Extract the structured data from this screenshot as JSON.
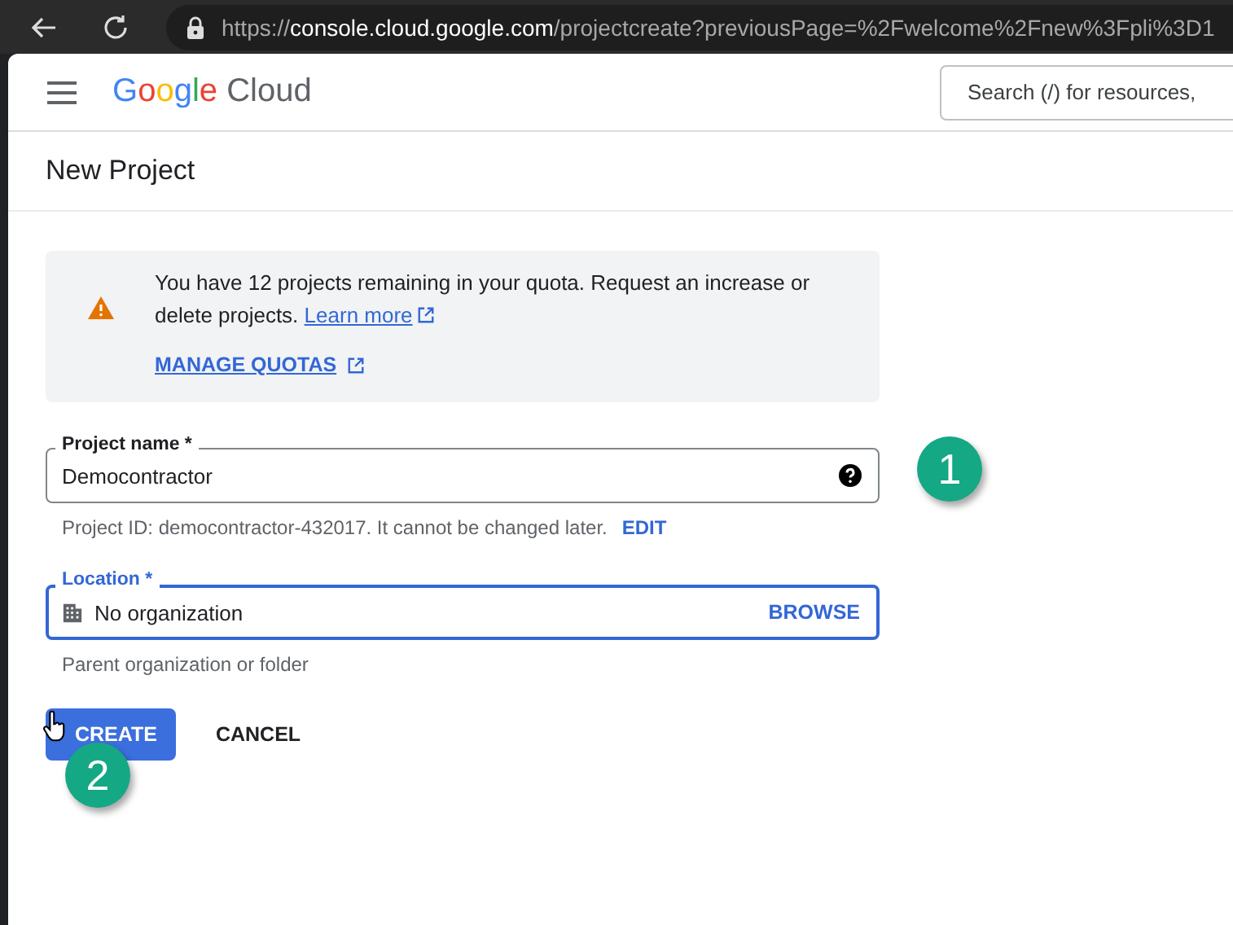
{
  "browser": {
    "url": {
      "scheme": "https://",
      "host": "console.cloud.google.com",
      "path": "/projectcreate?previousPage=%2Fwelcome%2Fnew%3Fpli%3D1"
    }
  },
  "header": {
    "logo": {
      "brand": "Google",
      "product": "Cloud"
    },
    "search": {
      "placeholder": "Search (/) for resources,"
    }
  },
  "page": {
    "title": "New Project"
  },
  "notice": {
    "text": "You have 12 projects remaining in your quota. Request an increase or delete projects.",
    "link": "Learn more",
    "action": "MANAGE QUOTAS"
  },
  "fields": [
    {
      "kind": "text",
      "label": "Project name *",
      "value": "Democontractor",
      "focused": false,
      "hint": "Project ID: democontractor-432017. It cannot be changed later.",
      "hint_action": "EDIT"
    },
    {
      "kind": "picker",
      "label": "Location *",
      "value": "No organization",
      "focused": true,
      "action": "BROWSE",
      "hint": "Parent organization or folder"
    }
  ],
  "buttons": [
    {
      "label": "CREATE",
      "kind": "primary"
    },
    {
      "label": "CANCEL",
      "kind": "text"
    }
  ],
  "annotations": [
    {
      "label": "1"
    },
    {
      "label": "2"
    }
  ]
}
